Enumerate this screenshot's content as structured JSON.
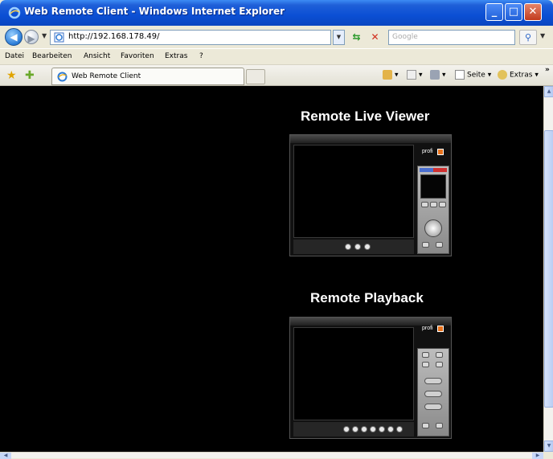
{
  "window": {
    "title": "Web Remote Client - Windows Internet Explorer"
  },
  "nav": {
    "url": "http://192.168.178.49/",
    "search_placeholder": "Google"
  },
  "menu": {
    "items": [
      "Datei",
      "Bearbeiten",
      "Ansicht",
      "Favoriten",
      "Extras",
      "?"
    ]
  },
  "tabs": {
    "active_label": "Web Remote Client"
  },
  "toolbar": {
    "page_label": "Seite",
    "tools_label": "Extras",
    "overflow": "»"
  },
  "content": {
    "live_viewer_title": "Remote Live Viewer",
    "playback_title": "Remote Playback",
    "brand_label": "profi"
  },
  "colors": {
    "titlebar": "#0b4fd4",
    "page_background": "#000000",
    "brand_orange": "#e8721c"
  }
}
